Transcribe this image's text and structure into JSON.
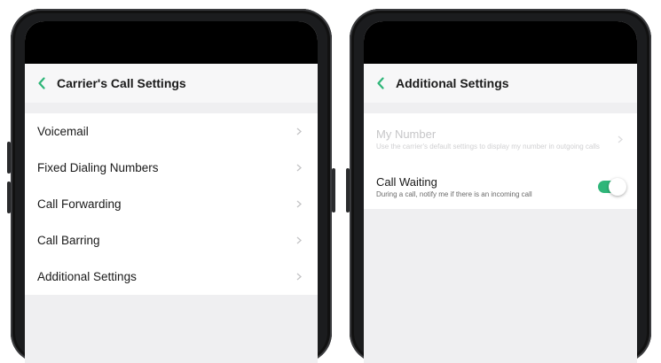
{
  "left_screen": {
    "title": "Carrier's Call Settings",
    "items": [
      {
        "label": "Voicemail"
      },
      {
        "label": "Fixed Dialing Numbers"
      },
      {
        "label": "Call Forwarding"
      },
      {
        "label": "Call Barring"
      },
      {
        "label": "Additional Settings"
      }
    ]
  },
  "right_screen": {
    "title": "Additional Settings",
    "my_number": {
      "label": "My Number",
      "description": "Use the carrier's default settings to display my number in outgoing calls",
      "enabled": false
    },
    "call_waiting": {
      "label": "Call Waiting",
      "description": "During a call, notify me if there is an incoming call",
      "toggle_on": true
    }
  },
  "colors": {
    "accent": "#2fb679",
    "background": "#efeff1",
    "text": "#1a1a1a"
  },
  "icons": [
    "back-chevron-icon",
    "chevron-right-icon",
    "toggle-switch"
  ]
}
